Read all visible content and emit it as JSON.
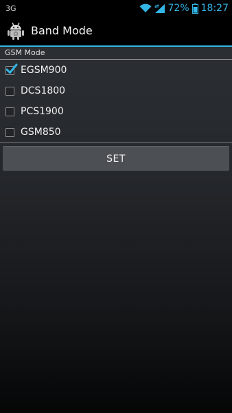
{
  "status_bar": {
    "network_type": "3G",
    "battery_percent": "72%",
    "time": "18:27",
    "icons": [
      "wifi-icon",
      "signal-icon",
      "battery-icon"
    ],
    "accent_color": "#33b5e5"
  },
  "app_bar": {
    "title": "Band Mode",
    "icon": "android-robot-icon"
  },
  "section": {
    "label": "GSM Mode"
  },
  "bands": [
    {
      "label": "EGSM900",
      "checked": true
    },
    {
      "label": "DCS1800",
      "checked": false
    },
    {
      "label": "PCS1900",
      "checked": false
    },
    {
      "label": "GSM850",
      "checked": false
    }
  ],
  "set_button": {
    "label": "SET"
  }
}
